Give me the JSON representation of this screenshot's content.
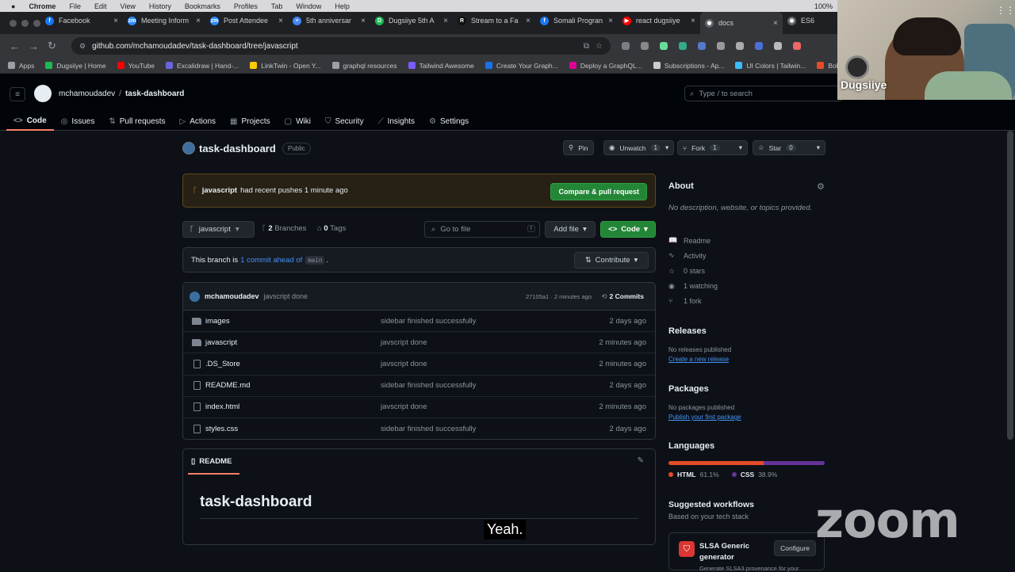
{
  "macos_menu": {
    "app": "Chrome",
    "items": [
      "File",
      "Edit",
      "View",
      "History",
      "Bookmarks",
      "Profiles",
      "Tab",
      "Window",
      "Help"
    ],
    "battery": "100%"
  },
  "browser_tabs": [
    {
      "title": "Facebook",
      "color": "#1877f2",
      "glyph": "f"
    },
    {
      "title": "Meeting Inform",
      "color": "#2d8cff",
      "glyph": "zm"
    },
    {
      "title": "Post Attendee",
      "color": "#2d8cff",
      "glyph": "zm"
    },
    {
      "title": "5th anniversar",
      "color": "#4285f4",
      "glyph": "≡"
    },
    {
      "title": "Dugsiiye 5th A",
      "color": "#1db954",
      "glyph": "D"
    },
    {
      "title": "Stream to a Fa",
      "color": "#111111",
      "glyph": "R"
    },
    {
      "title": "Somali Progran",
      "color": "#1877f2",
      "glyph": "f"
    },
    {
      "title": "react dugsiiye",
      "color": "#ff0000",
      "glyph": "▶"
    },
    {
      "title": "docs",
      "color": "#5f6368",
      "glyph": "◉"
    },
    {
      "title": "ES6",
      "color": "#5f6368",
      "glyph": "◉"
    }
  ],
  "address_bar": {
    "url": "github.com/mchamoudadev/task-dashboard/tree/javascript"
  },
  "bookmarks": [
    {
      "label": "Apps",
      "color": "#9aa0a6"
    },
    {
      "label": "Dugsiiye | Home",
      "color": "#1db954"
    },
    {
      "label": "YouTube",
      "color": "#ff0000"
    },
    {
      "label": "Excalidraw | Hand-...",
      "color": "#6965db"
    },
    {
      "label": "LinkTwin - Open Y...",
      "color": "#ffcc00"
    },
    {
      "label": "graphql resources",
      "color": "#9aa0a6"
    },
    {
      "label": "Tailwind Awesome",
      "color": "#7b5cff"
    },
    {
      "label": "Create Your Graph...",
      "color": "#1a73e8"
    },
    {
      "label": "Deploy a GraphQL...",
      "color": "#e10098"
    },
    {
      "label": "Subscriptions - Ap...",
      "color": "#cccccc"
    },
    {
      "label": "UI Colors | Tailwin...",
      "color": "#38bdf8"
    },
    {
      "label": "Bold Text",
      "color": "#e44d26"
    }
  ],
  "github": {
    "owner": "mchamoudadev",
    "repo": "task-dashboard",
    "search_placeholder": "Type / to search",
    "tabs": [
      {
        "label": "Code",
        "icon": "<>"
      },
      {
        "label": "Issues",
        "icon": "◎"
      },
      {
        "label": "Pull requests",
        "icon": "⇅"
      },
      {
        "label": "Actions",
        "icon": "▷"
      },
      {
        "label": "Projects",
        "icon": "▦"
      },
      {
        "label": "Wiki",
        "icon": "▢"
      },
      {
        "label": "Security",
        "icon": "⛉"
      },
      {
        "label": "Insights",
        "icon": "⟋"
      },
      {
        "label": "Settings",
        "icon": "⚙"
      }
    ],
    "visibility": "Public",
    "pin_label": "Pin",
    "unwatch_label": "Unwatch",
    "watch_count": "1",
    "fork_label": "Fork",
    "fork_count": "1",
    "star_label": "Star",
    "star_count": "0",
    "banner": {
      "branch": "javascript",
      "text": "had recent pushes 1 minute ago",
      "button": "Compare & pull request"
    },
    "branch": "javascript",
    "branches_count": "2",
    "branches_label": "Branches",
    "tags_count": "0",
    "tags_label": "Tags",
    "goto_placeholder": "Go to file",
    "goto_kbd": "t",
    "add_file_label": "Add file",
    "code_label": "Code",
    "ahead": {
      "prefix": "This branch is",
      "link": "1 commit ahead of",
      "base": "main",
      "suffix": ".",
      "contribute": "Contribute"
    },
    "latest_commit": {
      "author": "mchamoudadev",
      "message": "javscript done",
      "hash": "27105a1 · 2 minutes ago",
      "commits": "2 Commits"
    },
    "files": [
      {
        "name": "images",
        "type": "folder",
        "message": "sidebar finished successfully",
        "date": "2 days ago"
      },
      {
        "name": "javascript",
        "type": "folder",
        "message": "javscript done",
        "date": "2 minutes ago"
      },
      {
        "name": ".DS_Store",
        "type": "file",
        "message": "javscript done",
        "date": "2 minutes ago"
      },
      {
        "name": "README.md",
        "type": "file",
        "message": "sidebar finished successfully",
        "date": "2 days ago"
      },
      {
        "name": "index.html",
        "type": "file",
        "message": "javscript done",
        "date": "2 minutes ago"
      },
      {
        "name": "styles.css",
        "type": "file",
        "message": "sidebar finished successfully",
        "date": "2 days ago"
      }
    ],
    "readme": {
      "tab": "README",
      "title": "task-dashboard"
    },
    "about": {
      "heading": "About",
      "description": "No description, website, or topics provided.",
      "items": [
        {
          "icon": "📖",
          "label": "Readme"
        },
        {
          "icon": "∿",
          "label": "Activity"
        },
        {
          "icon": "☆",
          "label": "0 stars"
        },
        {
          "icon": "◉",
          "label": "1 watching"
        },
        {
          "icon": "⑂",
          "label": "1 fork"
        }
      ]
    },
    "releases": {
      "heading": "Releases",
      "text": "No releases published",
      "link": "Create a new release"
    },
    "packages": {
      "heading": "Packages",
      "text": "No packages published",
      "link": "Publish your first package"
    },
    "languages": {
      "heading": "Languages",
      "items": [
        {
          "name": "HTML",
          "percent": 61.1,
          "percent_label": "61.1%",
          "color": "#e34c26"
        },
        {
          "name": "CSS",
          "percent": 38.9,
          "percent_label": "38.9%",
          "color": "#663399"
        }
      ]
    },
    "workflows": {
      "heading": "Suggested workflows",
      "subtitle": "Based on your tech stack",
      "item_name": "SLSA Generic generator",
      "item_desc": "Generate SLSA3 provenance for your",
      "button": "Configure"
    }
  },
  "webcam": {
    "name": "Dugsiiye"
  },
  "overlay": {
    "zoom_logo": "zoom",
    "caption": "Yeah."
  }
}
